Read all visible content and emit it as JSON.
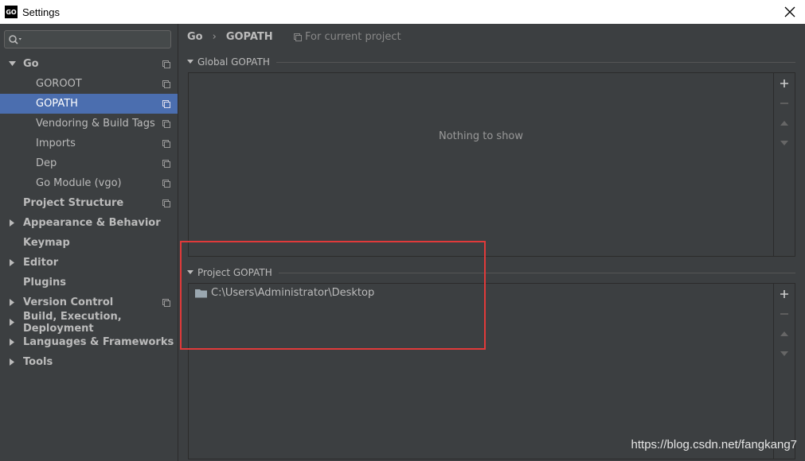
{
  "window": {
    "title": "Settings",
    "app_icon_text": "GO"
  },
  "search": {
    "placeholder": ""
  },
  "tree": [
    {
      "label": "Go",
      "level": 0,
      "expanded": true,
      "has_arrow": true,
      "project_icon": true,
      "selected": false
    },
    {
      "label": "GOROOT",
      "level": 1,
      "has_arrow": false,
      "project_icon": true,
      "selected": false
    },
    {
      "label": "GOPATH",
      "level": 1,
      "has_arrow": false,
      "project_icon": true,
      "selected": true
    },
    {
      "label": "Vendoring & Build Tags",
      "level": 1,
      "has_arrow": false,
      "project_icon": true,
      "selected": false
    },
    {
      "label": "Imports",
      "level": 1,
      "has_arrow": false,
      "project_icon": true,
      "selected": false
    },
    {
      "label": "Dep",
      "level": 1,
      "has_arrow": false,
      "project_icon": true,
      "selected": false
    },
    {
      "label": "Go Module (vgo)",
      "level": 1,
      "has_arrow": false,
      "project_icon": true,
      "selected": false
    },
    {
      "label": "Project Structure",
      "level": 0,
      "has_arrow": false,
      "project_icon": true,
      "selected": false
    },
    {
      "label": "Appearance & Behavior",
      "level": 0,
      "expanded": false,
      "has_arrow": true,
      "project_icon": false,
      "selected": false
    },
    {
      "label": "Keymap",
      "level": 0,
      "has_arrow": false,
      "project_icon": false,
      "selected": false
    },
    {
      "label": "Editor",
      "level": 0,
      "expanded": false,
      "has_arrow": true,
      "project_icon": false,
      "selected": false
    },
    {
      "label": "Plugins",
      "level": 0,
      "has_arrow": false,
      "project_icon": false,
      "selected": false
    },
    {
      "label": "Version Control",
      "level": 0,
      "expanded": false,
      "has_arrow": true,
      "project_icon": true,
      "selected": false
    },
    {
      "label": "Build, Execution, Deployment",
      "level": 0,
      "expanded": false,
      "has_arrow": true,
      "project_icon": false,
      "selected": false
    },
    {
      "label": "Languages & Frameworks",
      "level": 0,
      "expanded": false,
      "has_arrow": true,
      "project_icon": false,
      "selected": false
    },
    {
      "label": "Tools",
      "level": 0,
      "expanded": false,
      "has_arrow": true,
      "project_icon": false,
      "selected": false
    }
  ],
  "breadcrumb": {
    "parent": "Go",
    "current": "GOPATH",
    "separator": "›"
  },
  "scope_hint": "For current project",
  "global_gopath": {
    "title": "Global GOPATH",
    "empty_text": "Nothing to show"
  },
  "project_gopath": {
    "title": "Project GOPATH",
    "entries": [
      "C:\\Users\\Administrator\\Desktop"
    ]
  },
  "watermark": "https://blog.csdn.net/fangkang7",
  "colors": {
    "selection": "#4b6eaf",
    "background": "#3c3f41",
    "highlight": "#e03a3a"
  },
  "icons": {
    "close": "close-icon",
    "search": "search-icon",
    "folder": "folder-icon",
    "project_scope": "project-scope-icon"
  }
}
